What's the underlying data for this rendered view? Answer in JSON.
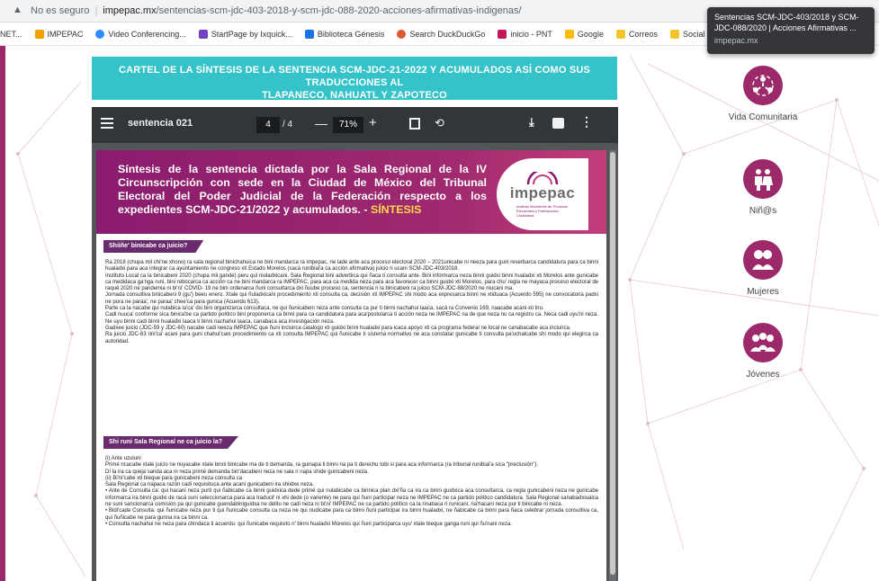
{
  "browser": {
    "security_warning": "No es seguro",
    "host": "impepac.mx",
    "path": "/sentencias-scm-jdc-403-2018-y-scm-jdc-088-2020-acciones-afirmativas-indigenas/",
    "bookmarks": [
      "NET...",
      "IMPEPAC",
      "Video Conferencing...",
      "StartPage by Ixquick...",
      "Biblioteca Génesis",
      "Search DuckDuckGo",
      "inicio - PNT",
      "Google",
      "Correos",
      "Social"
    ],
    "bookmark_colors": [
      "#f4a000",
      "#4285f4",
      "#2d8cff",
      "#6f42c1",
      "#1a73e8",
      "#de5833",
      "#c2185b",
      "#fbbc05",
      "#f4c430",
      "#f4c430"
    ],
    "tooltip": {
      "title": "Sentencias SCM-JDC-403/2018 y SCM-JDC-088/2020 | Acciones Afirmativas ...",
      "domain": "impepac.mx"
    }
  },
  "banner": {
    "line1": "CARTEL DE LA SÍNTESIS DE LA SENTENCIA SCM-JDC-21-2022 Y ACUMULADOS ASÍ COMO SUS TRADUCCIONES AL",
    "line2": "TLAPANECO, NAHUATL Y ZAPOTECO"
  },
  "pdf": {
    "title": "sentencia 021",
    "page_current": "4",
    "page_total": "/ 4",
    "zoom": "71%",
    "header_text": "Síntesis de la sentencia dictada por la Sala Regional de la IV Circunscripción con sede en la Ciudad de México del Tribunal Electoral del Poder Judicial de la Federación respecto a los expedientes SCM-JDC-21/2022 y acumulados. -",
    "header_highlight": "SÍNTESIS",
    "logo_name": "impepac",
    "logo_sub": "Instituto Morelense de Procesos Electorales y Participación Ciudadana",
    "section1": "Shiiñe' binicabe ca juicio?",
    "section1_paragraphs": [
      "Ra 2018 (chupa mil chi'ne xhono) ra sala regional binichahuica ne bini mandarca ra impepac, ne lade ante aca proceso electoral 2020 – 2021unicabe ni neeza para guni reserbarca candidatura para ca binni hualadxi para aca integrar ca ayuntamiento ne congreso xti Estado Morelos (sacá runibiaǐ'a ca acción afirmativa) juicio ri ucani SCM-JDC-403/2018.",
      "Instituto Local ca la binicabeni 2020 (chupa mil gande) peru qui niuladxicani. Sala Regional bini advertiica qui ñaca ti consulta ante. Bini informarca neza binni guidxi binni hualadxi xti Morelos ante gunicabe ca medidaca ga'nga runi, bini rebocarca ca acción ca ne bini mandarca ra IMPEPAC, para aca ca medida neza para aca favorecer ca binni guidxi xti Morelos, para chu' regla ne mayaca proceso electoral de raquë 2020 ne pandemia ni bi'ni' COVID- 19 ne bini ordenarca ñuni consultarca dxi ñuube proceso ca, sentencia ri la binicabeni ra juicio SCM-JDC-88/2020 ne niucani ma.",
      "Jornada consultiva binicabeni 9 (gu') beeu enero. Xtale qui ñuladxicani procedimiento xti consulta ca, decisión xti IMPEPAC shi modo aca expresarca binni ne xtiduaca (Acuerdo 595) ne convocatoria padxi ne pora ne paraa', ne paraa' chee'ca para gunica (Acuerdo 613).",
      "Parte ca la nacabe qui nulabica la'ca' dxi bini organizarca consultaca, ne qui ñunicabeni neza ante consulta ca pur ti binni nachahui laaca, sacá ra Convenio 169, naacabe acani xti tiru.",
      "Cadi nuuca' conforme sica binica'be ca partido político bini proponerca ca binni para ca candidatura para aca'postularca ti acción neza ne IMPEPAC na de que neza nu ca registru ca. Neca cadi uyu'ni neza. Ne uyu binni cadi binni hualadxi laaca ti binni nachahui laaca, canabaca aca investigación neza.",
      "Gadxee juicio (JDC-59 y JDC-60) nacabe cadi neeza IMPEPAC que ñuni incluirca catalogo xti guidxi binni hualadxi para icaca apoyo xti ca programa federal ne local ne canabacabe aca incluirca.",
      "Ra juicio JDC-63 rini'ca' acani para guni chahui'cani procedimiento ca xti consulta IMPEPAC qui ñunicabe ti sistema normativo ne aca constatar gunicabe ti consulta pa'uchalcabe shi modo qui elegirca ca autoridad."
    ],
    "section2": "Shi runi Sala Regional ne ca juicio la?",
    "section2_paragraphs": [
      "(i) Ante uzuluni",
      "Primé ricacabe xtale juicio ne nuyacabe xtale binni binicabe ma de ti demanda, ra guinapa ti binni na pa ti derechu tobi si para aca informarca (ra tribunal runibiaǐ'a sica \"preclusión\").",
      "Dí la ira ca queja sanda aca ni neza primé demanda bin'dacabeni neza ne sala ri napa shide gunicabeni neza.",
      "(ii) Bi'ni'cabe xti bieque para gunicabeni neza consulta ca",
      "Sala Regional ca napaca razón cadi requisituca ante acani gunicabeni ira shiidxe neza.",
      "• Ante de Consulta ca: qui hacani neza purti qui ñabicabe ca binni guidxica dede primé qui nulabicabe ca binnica plan dxi'ña ca ira ca binni guidxica aca consultarca, ca regla gunicabeni neza ne gunicabe informarca ira binni guidxi de racá suni seleccionarca para aca traduciř ni xhi dede (o variente) ne para qui ñuni participar neza ne IMPEPAC ne ca partido político candidatura. Sala Regional sanabadxiualca ne suni sancionarca comisión pa qui gunicabe guendabiniguidxa ne delitu ne cadi neza ni bi'ni' IMPEPAC ne ca partido político ca la rinabaca ri runicani, ria'hacani neza pur ti binicabe ni neza.",
      "• Bidi'cade Consulta: qui ñunicabe neza pur ti qui ñunicabe consulta ca neza ne qui nudicabe para ca binni ñuni participar ira binni hualadxi, ne ñabicabe ca binni para ñaca celebrar jornada consultiva ca, qui ñuñicabe ne para gunna ira ca binni ca.",
      "• Consulta nachahui ne neza para chindaca ti acuerdu: qui ñunicabe requisito ri' binni hualadxi Morelos qui ñuni participarca uyu' xtale bieque ganga runi qui ñu'nani neza."
    ]
  },
  "side_categories": [
    {
      "label": "Vida Comunitaria",
      "icon": "community-icon"
    },
    {
      "label": "Niñ@s",
      "icon": "children-icon"
    },
    {
      "label": "Mujeres",
      "icon": "women-icon"
    },
    {
      "label": "Jóvenes",
      "icon": "youth-icon"
    }
  ],
  "colors": {
    "accent": "#9c2a6a",
    "banner": "#35c3c9",
    "pdf_toolbar": "#323639",
    "pdf_background": "#525659",
    "highlight": "#ffd84a"
  }
}
